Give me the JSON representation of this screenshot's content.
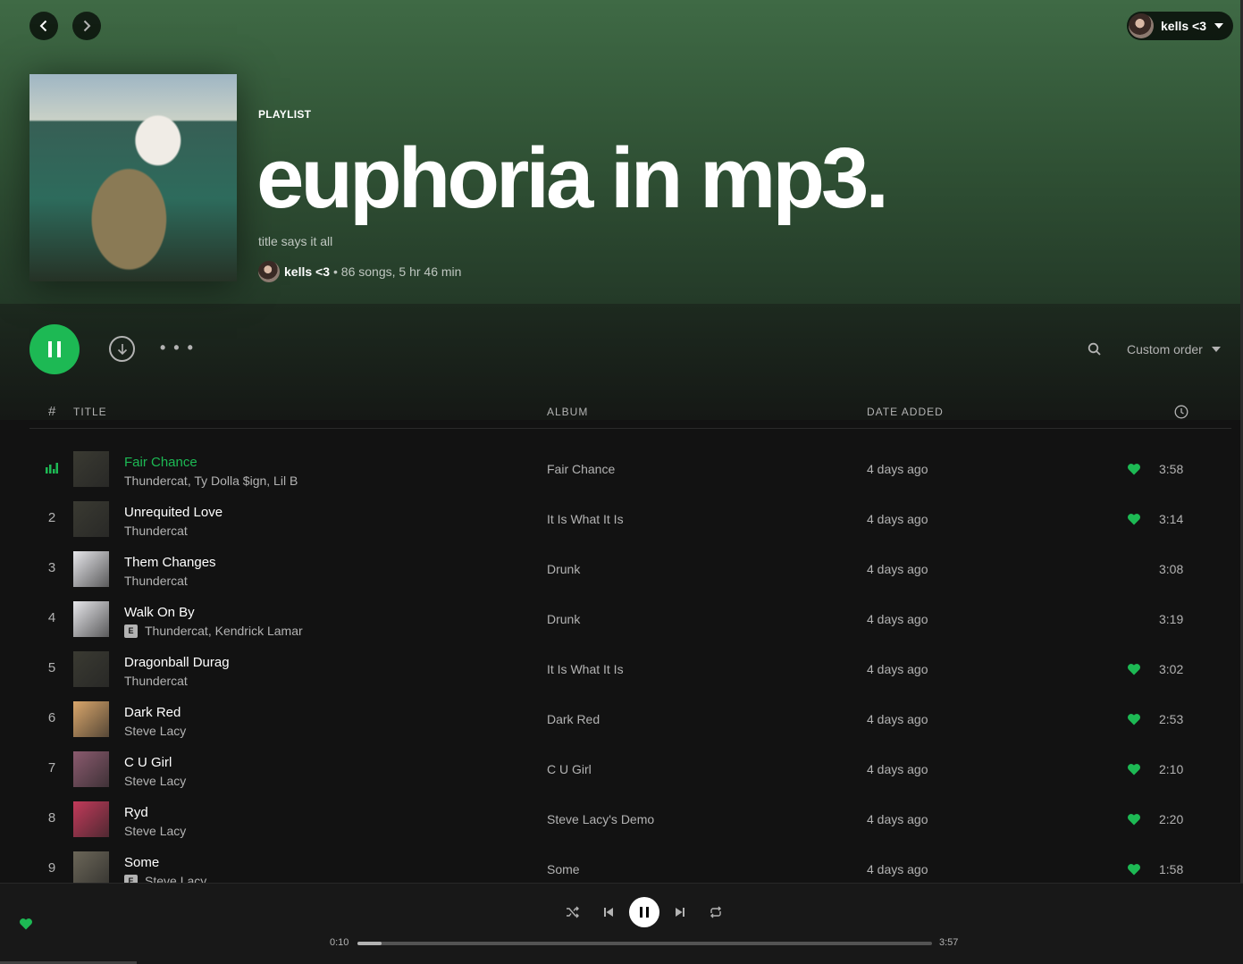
{
  "nav": {
    "back_icon": "chevron-left-icon",
    "forward_icon": "chevron-right-icon",
    "user_name": "kells <3"
  },
  "playlist": {
    "type": "PLAYLIST",
    "title": "euphoria in mp3.",
    "description": "title says it all",
    "owner": "kells <3",
    "stats": "• 86 songs, 5 hr 46 min"
  },
  "actions": {
    "sort_label": "Custom order",
    "more_label": "• • •"
  },
  "table": {
    "headers": {
      "num": "#",
      "title": "TITLE",
      "album": "ALBUM",
      "date": "DATE ADDED"
    },
    "rows": [
      {
        "num": "1",
        "title": "Fair Chance",
        "artist": "Thundercat, Ty Dolla $ign, Lil B",
        "explicit": false,
        "album": "Fair Chance",
        "date": "4 days ago",
        "liked": true,
        "duration": "3:58",
        "playing": true,
        "thumb": "#3a3a32"
      },
      {
        "num": "2",
        "title": "Unrequited Love",
        "artist": "Thundercat",
        "explicit": false,
        "album": "It Is What It Is",
        "date": "4 days ago",
        "liked": true,
        "duration": "3:14",
        "playing": false,
        "thumb": "#3a3a32"
      },
      {
        "num": "3",
        "title": "Them Changes",
        "artist": "Thundercat",
        "explicit": false,
        "album": "Drunk",
        "date": "4 days ago",
        "liked": false,
        "duration": "3:08",
        "playing": false,
        "thumb": "#e6e6ea"
      },
      {
        "num": "4",
        "title": "Walk On By",
        "artist": "Thundercat, Kendrick Lamar",
        "explicit": true,
        "album": "Drunk",
        "date": "4 days ago",
        "liked": false,
        "duration": "3:19",
        "playing": false,
        "thumb": "#e6e6ea"
      },
      {
        "num": "5",
        "title": "Dragonball Durag",
        "artist": "Thundercat",
        "explicit": false,
        "album": "It Is What It Is",
        "date": "4 days ago",
        "liked": true,
        "duration": "3:02",
        "playing": false,
        "thumb": "#3a3a32"
      },
      {
        "num": "6",
        "title": "Dark Red",
        "artist": "Steve Lacy",
        "explicit": false,
        "album": "Dark Red",
        "date": "4 days ago",
        "liked": true,
        "duration": "2:53",
        "playing": false,
        "thumb": "#d9a66b"
      },
      {
        "num": "7",
        "title": "C U Girl",
        "artist": "Steve Lacy",
        "explicit": false,
        "album": "C U Girl",
        "date": "4 days ago",
        "liked": true,
        "duration": "2:10",
        "playing": false,
        "thumb": "#8a5a6e"
      },
      {
        "num": "8",
        "title": "Ryd",
        "artist": "Steve Lacy",
        "explicit": false,
        "album": "Steve Lacy's Demo",
        "date": "4 days ago",
        "liked": true,
        "duration": "2:20",
        "playing": false,
        "thumb": "#c23a5a"
      },
      {
        "num": "9",
        "title": "Some",
        "artist": "Steve Lacy",
        "explicit": true,
        "album": "Some",
        "date": "4 days ago",
        "liked": true,
        "duration": "1:58",
        "playing": false,
        "thumb": "#6b6658"
      }
    ]
  },
  "player": {
    "elapsed": "0:10",
    "total": "3:57",
    "progress": 0.042
  },
  "colors": {
    "accent": "#1db954",
    "background": "#121212",
    "header": "#3f6a45"
  }
}
